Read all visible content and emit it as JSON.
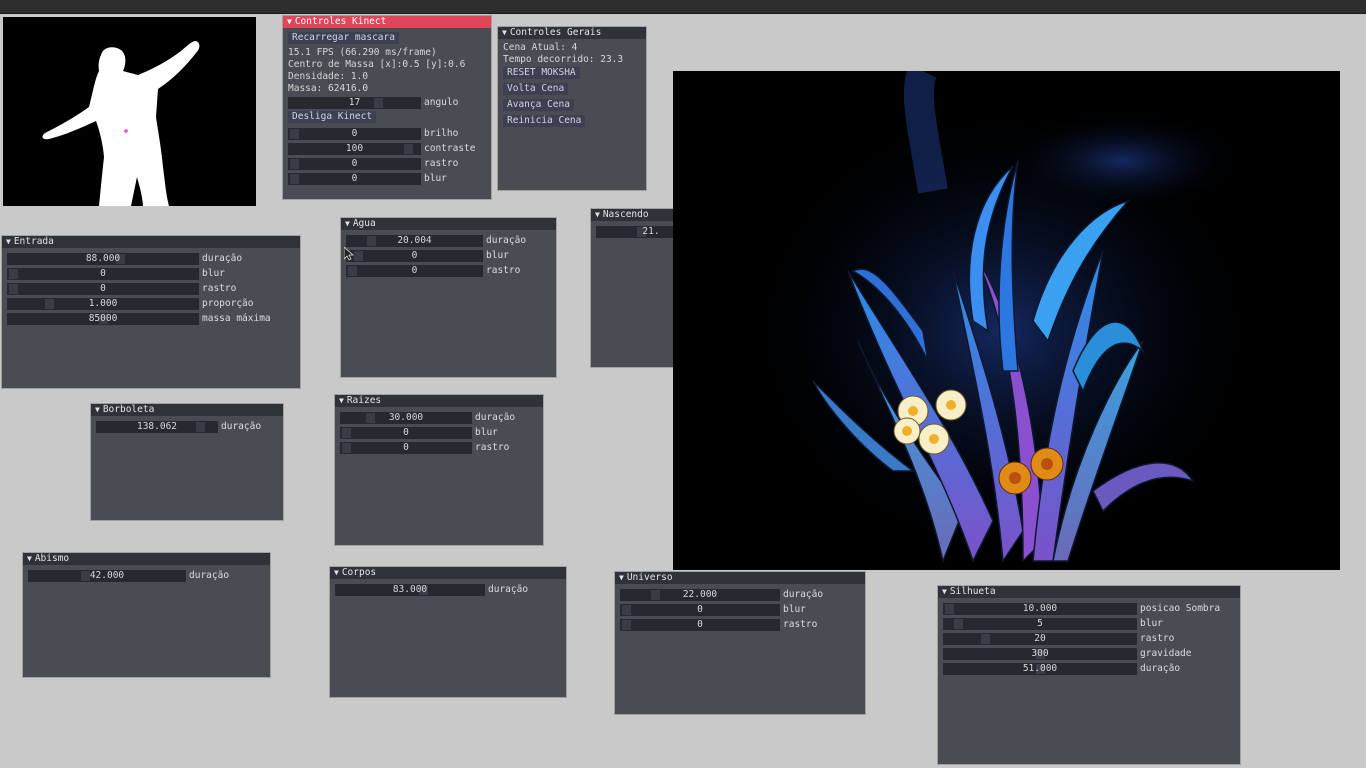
{
  "kinect": {
    "title": "Controles Kinect",
    "reload_button": "Recarregar mascara",
    "fps": "15.1 FPS (66.290 ms/frame)",
    "center_mass": "Centro de Massa [x]:0.5 [y]:0.6",
    "density": "Densidade: 1.0",
    "mass": "Massa: 62416.0",
    "angle": {
      "value": "17",
      "label": "angulo",
      "fraction": 0.7
    },
    "disable_button": "Desliga Kinect",
    "sliders": [
      {
        "value": "0",
        "label": "brilho",
        "fraction": 0.0
      },
      {
        "value": "100",
        "label": "contraste",
        "fraction": 0.95
      },
      {
        "value": "0",
        "label": "rastro",
        "fraction": 0.0
      },
      {
        "value": "0",
        "label": "blur",
        "fraction": 0.0
      }
    ]
  },
  "gerais": {
    "title": "Controles  Gerais",
    "scene": "Cena Atual: 4",
    "elapsed": "Tempo decorrido: 23.3",
    "buttons": [
      "RESET MOKSHA",
      "Volta Cena",
      "Avança Cena",
      "Reinicia Cena"
    ]
  },
  "entrada": {
    "title": "Entrada",
    "sliders": [
      {
        "value": "88.000",
        "label": "duração",
        "fraction": 0.6
      },
      {
        "value": "0",
        "label": "blur",
        "fraction": 0.0
      },
      {
        "value": "0",
        "label": "rastro",
        "fraction": 0.0
      },
      {
        "value": "1.000",
        "label": "proporção",
        "fraction": 0.2
      },
      {
        "value": "85000",
        "label": "massa máxima",
        "fraction": 0.5
      }
    ]
  },
  "agua": {
    "title": "Água",
    "sliders": [
      {
        "value": "20.004",
        "label": "duração",
        "fraction": 0.15
      },
      {
        "value": "0",
        "label": "blur",
        "fraction": 0.05
      },
      {
        "value": "0",
        "label": "rastro",
        "fraction": 0.0
      }
    ]
  },
  "nascendo": {
    "title": "Nascendo",
    "sliders": [
      {
        "value": "21.",
        "label": "",
        "fraction": 0.4
      }
    ]
  },
  "borboleta": {
    "title": "Borboleta",
    "sliders": [
      {
        "value": "138.062",
        "label": "duração",
        "fraction": 0.9
      }
    ]
  },
  "raizes": {
    "title": "Raizes",
    "sliders": [
      {
        "value": "30.000",
        "label": "duração",
        "fraction": 0.2
      },
      {
        "value": "0",
        "label": "blur",
        "fraction": 0.0
      },
      {
        "value": "0",
        "label": "rastro",
        "fraction": 0.0
      }
    ]
  },
  "abismo": {
    "title": "Abismo",
    "sliders": [
      {
        "value": "42.000",
        "label": "duração",
        "fraction": 0.35
      }
    ]
  },
  "corpos": {
    "title": "Corpos",
    "sliders": [
      {
        "value": "83.000",
        "label": "duração",
        "fraction": 0.6
      }
    ]
  },
  "universo": {
    "title": "Universo",
    "sliders": [
      {
        "value": "22.000",
        "label": "duração",
        "fraction": 0.2
      },
      {
        "value": "0",
        "label": "blur",
        "fraction": 0.0
      },
      {
        "value": "0",
        "label": "rastro",
        "fraction": 0.0
      }
    ]
  },
  "silhueta": {
    "title": "Silhueta",
    "sliders": [
      {
        "value": "10.000",
        "label": "posicao Sombra",
        "fraction": 0.0
      },
      {
        "value": "5",
        "label": "blur",
        "fraction": 0.05
      },
      {
        "value": "20",
        "label": "rastro",
        "fraction": 0.2
      },
      {
        "value": "300",
        "label": "gravidade",
        "fraction": 0.5
      },
      {
        "value": "51.000",
        "label": "duração",
        "fraction": 0.5
      }
    ]
  }
}
